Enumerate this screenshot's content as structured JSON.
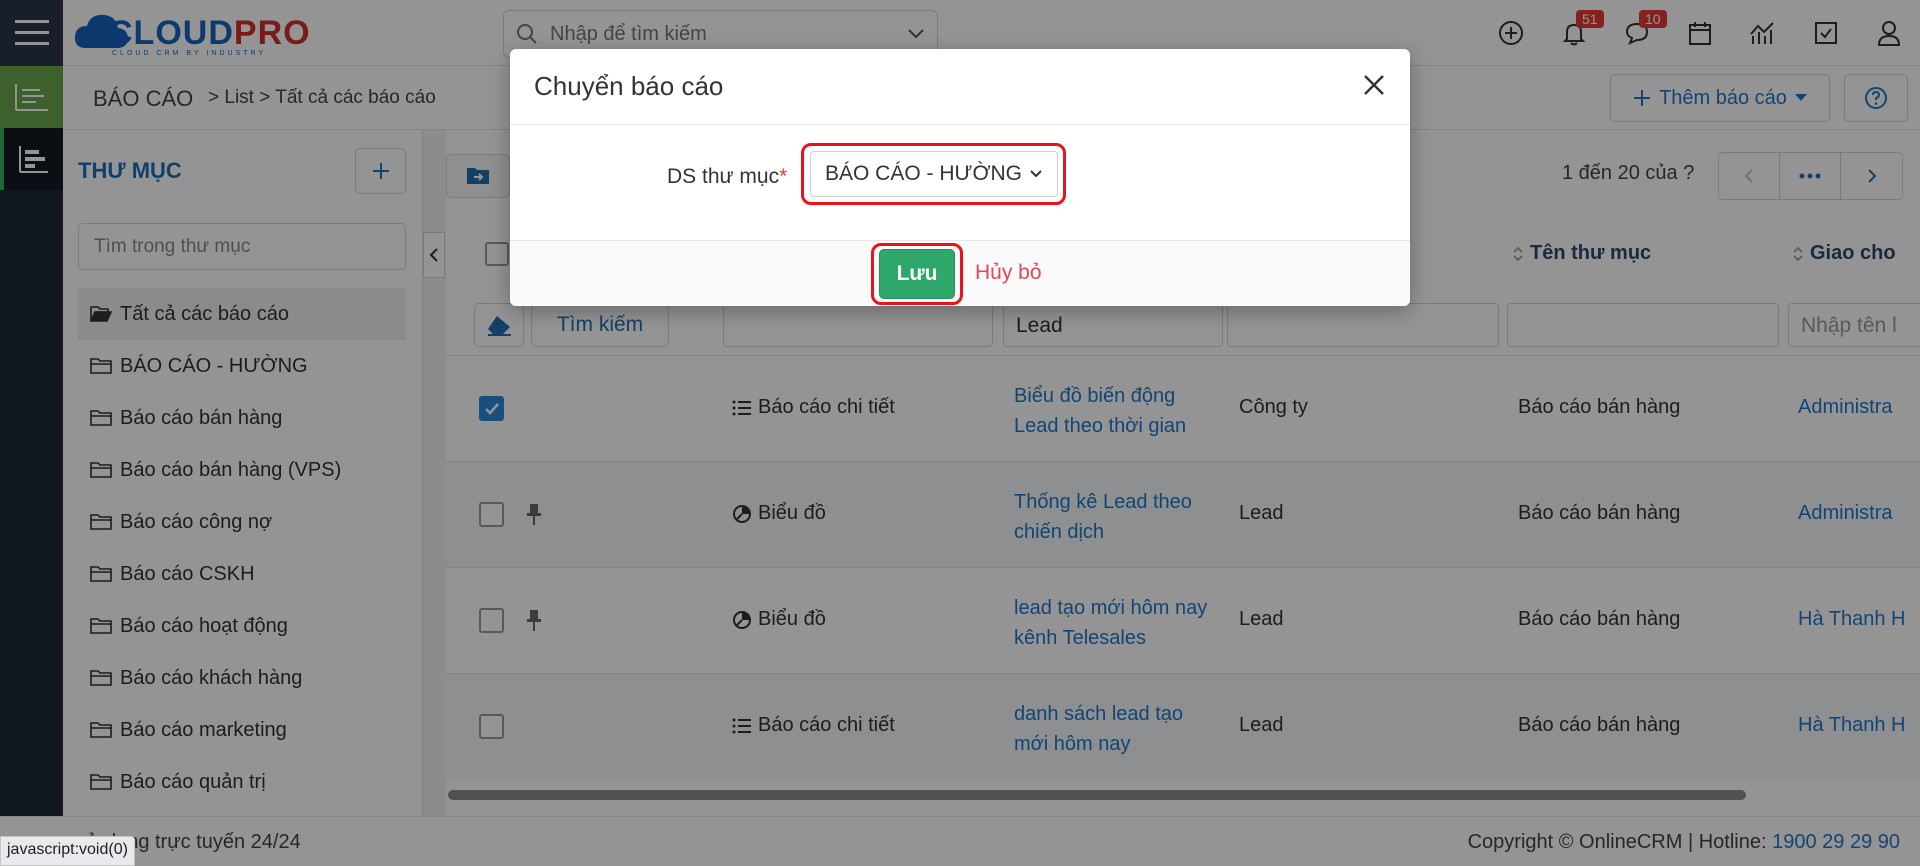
{
  "brand": {
    "logo_main": "CLOUD",
    "logo_accent": "PRO",
    "logo_sub": "CLOUD CRM BY INDUSTRY"
  },
  "topbar": {
    "search_placeholder": "Nhập để tìm kiếm",
    "notifications_count": "51",
    "messages_count": "10"
  },
  "header": {
    "breadcrumb_main": "BÁO CÁO",
    "breadcrumb_rest": "> List > Tất cả các báo cáo",
    "add_report_label": "Thêm báo cáo"
  },
  "folders": {
    "title": "THƯ MỤC",
    "search_placeholder": "Tìm trong thư mục",
    "items": [
      "Tất cả các báo cáo",
      "BÁO CÁO - HƯỜNG",
      "Báo cáo bán hàng",
      "Báo cáo bán hàng (VPS)",
      "Báo cáo công nợ",
      "Báo cáo CSKH",
      "Báo cáo hoạt động",
      "Báo cáo khách hàng",
      "Báo cáo marketing",
      "Báo cáo quản trị"
    ]
  },
  "list": {
    "pager_text": "1 đến 20 của",
    "pager_unknown": "?",
    "columns": {
      "folder": "Tên thư mục",
      "assigned": "Giao cho"
    },
    "filters": {
      "search_btn": "Tìm kiếm",
      "name_value": "Lead",
      "assigned_placeholder": "Nhập tên l"
    },
    "rows": [
      {
        "checked": true,
        "pinned": false,
        "type_icon": "list-icon",
        "type": "Báo cáo chi tiết",
        "name": "Biểu đồ biến động Lead theo thời gian",
        "module": "Công ty",
        "folder": "Báo cáo bán hàng",
        "owner": "Administra"
      },
      {
        "checked": false,
        "pinned": true,
        "type_icon": "chart-icon",
        "type": "Biểu đồ",
        "name": "Thống kê Lead theo chiến dịch",
        "module": "Lead",
        "folder": "Báo cáo bán hàng",
        "owner": "Administra"
      },
      {
        "checked": false,
        "pinned": true,
        "type_icon": "chart-icon",
        "type": "Biểu đồ",
        "name": "lead tạo mới hôm nay kênh Telesales",
        "module": "Lead",
        "folder": "Báo cáo bán hàng",
        "owner": "Hà Thanh H"
      },
      {
        "checked": false,
        "pinned": false,
        "type_icon": "list-icon",
        "type": "Báo cáo chi tiết",
        "name": "danh sách lead tạo mới hôm nay",
        "module": "Lead",
        "folder": "Báo cáo bán hàng",
        "owner": "Hà Thanh H"
      }
    ]
  },
  "footer": {
    "left": "sử dụng trực tuyến 24/24",
    "copyright": "Copyright © OnlineCRM | Hotline: ",
    "hotline": "1900 29 29 90",
    "status_url": "javascript:void(0)"
  },
  "modal": {
    "title": "Chuyển báo cáo",
    "field_label": "DS thư mục",
    "required_mark": "*",
    "selected_folder": "BÁO CÁO - HƯỜNG",
    "save_label": "Lưu",
    "cancel_label": "Hủy bỏ"
  },
  "colors": {
    "accent": "#1f78c8",
    "save": "#2ea86a",
    "highlight": "#e8131c",
    "cancel": "#e0475a"
  }
}
